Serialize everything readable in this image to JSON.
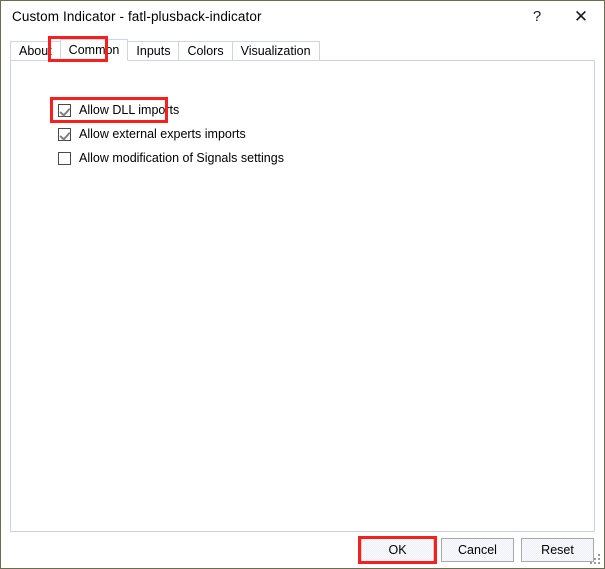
{
  "window": {
    "title": "Custom Indicator - fatl-plusback-indicator",
    "help_glyph": "?",
    "close_glyph": "✕",
    "border_color": "#6b6b4e"
  },
  "tabs": [
    {
      "label": "About",
      "selected": false
    },
    {
      "label": "Common",
      "selected": true
    },
    {
      "label": "Inputs",
      "selected": false
    },
    {
      "label": "Colors",
      "selected": false
    },
    {
      "label": "Visualization",
      "selected": false
    }
  ],
  "common_tab": {
    "options": [
      {
        "label": "Allow DLL imports",
        "checked": true
      },
      {
        "label": "Allow external experts imports",
        "checked": true
      },
      {
        "label": "Allow modification of Signals settings",
        "checked": false
      }
    ]
  },
  "footer": {
    "ok_label": "OK",
    "cancel_label": "Cancel",
    "reset_label": "Reset"
  },
  "annotations": {
    "color": "#f81f1f",
    "targets": [
      "Common tab",
      "Allow DLL imports checkbox",
      "OK button"
    ]
  }
}
